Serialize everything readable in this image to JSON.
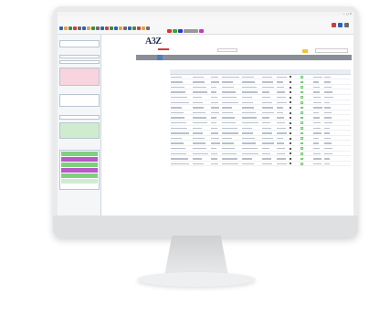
{
  "window": {
    "title": "",
    "controls": "— ▢ ✕"
  },
  "toolbar": {
    "menu": ""
  },
  "app": {
    "logo_text": "A3Z"
  },
  "sidebar": {
    "items": [
      {
        "label": ""
      },
      {
        "label": ""
      },
      {
        "label": ""
      },
      {
        "label": ""
      },
      {
        "label": ""
      }
    ]
  },
  "nav": {
    "tabs": [
      {
        "label": ""
      },
      {
        "label": ""
      },
      {
        "label": ""
      },
      {
        "label": ""
      },
      {
        "label": ""
      },
      {
        "label": ""
      }
    ],
    "active_index": 3
  },
  "content_left": {
    "items": [
      "",
      "",
      "",
      "",
      "",
      ""
    ]
  },
  "grid": {
    "columns": [
      "",
      "",
      "",
      "",
      "",
      "",
      "",
      "",
      "",
      "",
      ""
    ],
    "rows": 18
  },
  "colors": {
    "accent": "#4a7fc0",
    "nav_bg": "#8a8f97",
    "logo": "#1f2d4f",
    "logo_mark": "#d03838",
    "sidebar_pink": "#f7d4de",
    "sidebar_green": "#7fcf7f",
    "sidebar_purple": "#b55ac6"
  }
}
